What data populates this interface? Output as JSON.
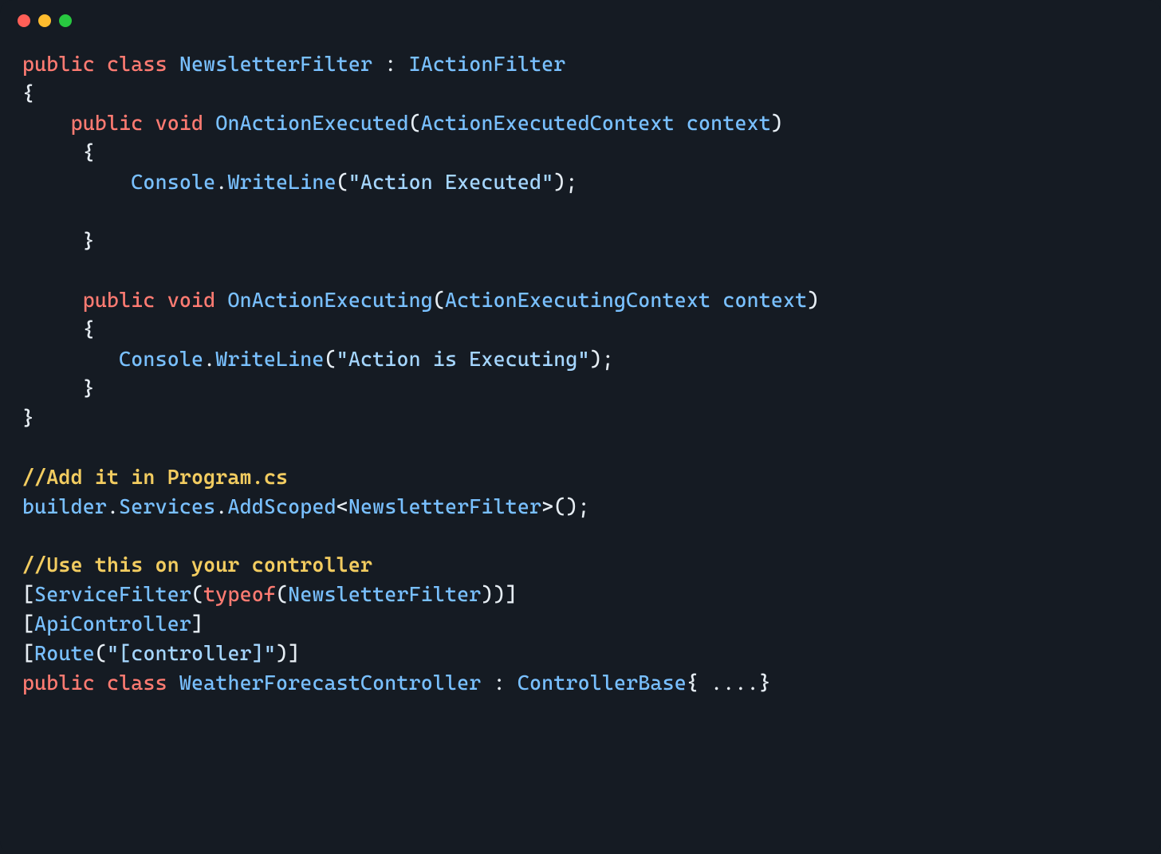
{
  "titlebar": {
    "dots": [
      "close",
      "minimize",
      "maximize"
    ]
  },
  "code": {
    "lines": [
      {
        "segments": [
          {
            "t": "public",
            "c": "kw"
          },
          {
            "t": " ",
            "c": "punc"
          },
          {
            "t": "class",
            "c": "kw"
          },
          {
            "t": " ",
            "c": "punc"
          },
          {
            "t": "NewsletterFilter",
            "c": "type"
          },
          {
            "t": " : ",
            "c": "punc"
          },
          {
            "t": "IActionFilter",
            "c": "type"
          }
        ]
      },
      {
        "segments": [
          {
            "t": "{",
            "c": "punc"
          }
        ]
      },
      {
        "segments": [
          {
            "t": "    ",
            "c": "punc"
          },
          {
            "t": "public",
            "c": "kw"
          },
          {
            "t": " ",
            "c": "punc"
          },
          {
            "t": "void",
            "c": "kw"
          },
          {
            "t": " ",
            "c": "punc"
          },
          {
            "t": "OnActionExecuted",
            "c": "method"
          },
          {
            "t": "(",
            "c": "paren"
          },
          {
            "t": "ActionExecutedContext",
            "c": "type"
          },
          {
            "t": " ",
            "c": "punc"
          },
          {
            "t": "context",
            "c": "var"
          },
          {
            "t": ")",
            "c": "paren"
          }
        ]
      },
      {
        "segments": [
          {
            "t": "     {",
            "c": "punc"
          }
        ]
      },
      {
        "segments": [
          {
            "t": "         ",
            "c": "punc"
          },
          {
            "t": "Console",
            "c": "type"
          },
          {
            "t": ".",
            "c": "punc"
          },
          {
            "t": "WriteLine",
            "c": "method"
          },
          {
            "t": "(",
            "c": "paren"
          },
          {
            "t": "\"Action Executed\"",
            "c": "str"
          },
          {
            "t": ");",
            "c": "punc"
          }
        ]
      },
      {
        "segments": [
          {
            "t": " ",
            "c": "punc"
          }
        ]
      },
      {
        "segments": [
          {
            "t": "     }",
            "c": "punc"
          }
        ]
      },
      {
        "segments": [
          {
            "t": " ",
            "c": "punc"
          }
        ]
      },
      {
        "segments": [
          {
            "t": "     ",
            "c": "punc"
          },
          {
            "t": "public",
            "c": "kw"
          },
          {
            "t": " ",
            "c": "punc"
          },
          {
            "t": "void",
            "c": "kw"
          },
          {
            "t": " ",
            "c": "punc"
          },
          {
            "t": "OnActionExecuting",
            "c": "method"
          },
          {
            "t": "(",
            "c": "paren"
          },
          {
            "t": "ActionExecutingContext",
            "c": "type"
          },
          {
            "t": " ",
            "c": "punc"
          },
          {
            "t": "context",
            "c": "var"
          },
          {
            "t": ")",
            "c": "paren"
          }
        ]
      },
      {
        "segments": [
          {
            "t": "     {",
            "c": "punc"
          }
        ]
      },
      {
        "segments": [
          {
            "t": "        ",
            "c": "punc"
          },
          {
            "t": "Console",
            "c": "type"
          },
          {
            "t": ".",
            "c": "punc"
          },
          {
            "t": "WriteLine",
            "c": "method"
          },
          {
            "t": "(",
            "c": "paren"
          },
          {
            "t": "\"Action is Executing\"",
            "c": "str"
          },
          {
            "t": ");",
            "c": "punc"
          }
        ]
      },
      {
        "segments": [
          {
            "t": "     }",
            "c": "punc"
          }
        ]
      },
      {
        "segments": [
          {
            "t": "}",
            "c": "punc"
          }
        ]
      },
      {
        "segments": [
          {
            "t": " ",
            "c": "punc"
          }
        ]
      },
      {
        "segments": [
          {
            "t": "//Add it in Program.cs",
            "c": "comment"
          }
        ]
      },
      {
        "segments": [
          {
            "t": "builder",
            "c": "var"
          },
          {
            "t": ".",
            "c": "punc"
          },
          {
            "t": "Services",
            "c": "var"
          },
          {
            "t": ".",
            "c": "punc"
          },
          {
            "t": "AddScoped",
            "c": "method"
          },
          {
            "t": "<",
            "c": "punc"
          },
          {
            "t": "NewsletterFilter",
            "c": "type"
          },
          {
            "t": ">",
            "c": "punc"
          },
          {
            "t": "();",
            "c": "punc"
          }
        ]
      },
      {
        "segments": [
          {
            "t": " ",
            "c": "punc"
          }
        ]
      },
      {
        "segments": [
          {
            "t": "//Use this on your controller",
            "c": "comment"
          }
        ]
      },
      {
        "segments": [
          {
            "t": "[",
            "c": "punc"
          },
          {
            "t": "ServiceFilter",
            "c": "type"
          },
          {
            "t": "(",
            "c": "paren"
          },
          {
            "t": "typeof",
            "c": "kw"
          },
          {
            "t": "(",
            "c": "paren"
          },
          {
            "t": "NewsletterFilter",
            "c": "type"
          },
          {
            "t": "))]",
            "c": "punc"
          }
        ]
      },
      {
        "segments": [
          {
            "t": "[",
            "c": "punc"
          },
          {
            "t": "ApiController",
            "c": "type"
          },
          {
            "t": "]",
            "c": "punc"
          }
        ]
      },
      {
        "segments": [
          {
            "t": "[",
            "c": "punc"
          },
          {
            "t": "Route",
            "c": "type"
          },
          {
            "t": "(",
            "c": "paren"
          },
          {
            "t": "\"[controller]\"",
            "c": "str"
          },
          {
            "t": ")]",
            "c": "punc"
          }
        ]
      },
      {
        "segments": [
          {
            "t": "public",
            "c": "kw"
          },
          {
            "t": " ",
            "c": "punc"
          },
          {
            "t": "class",
            "c": "kw"
          },
          {
            "t": " ",
            "c": "punc"
          },
          {
            "t": "WeatherForecastController",
            "c": "type"
          },
          {
            "t": " : ",
            "c": "punc"
          },
          {
            "t": "ControllerBase",
            "c": "type"
          },
          {
            "t": "{ ....}",
            "c": "punc"
          }
        ]
      }
    ]
  }
}
